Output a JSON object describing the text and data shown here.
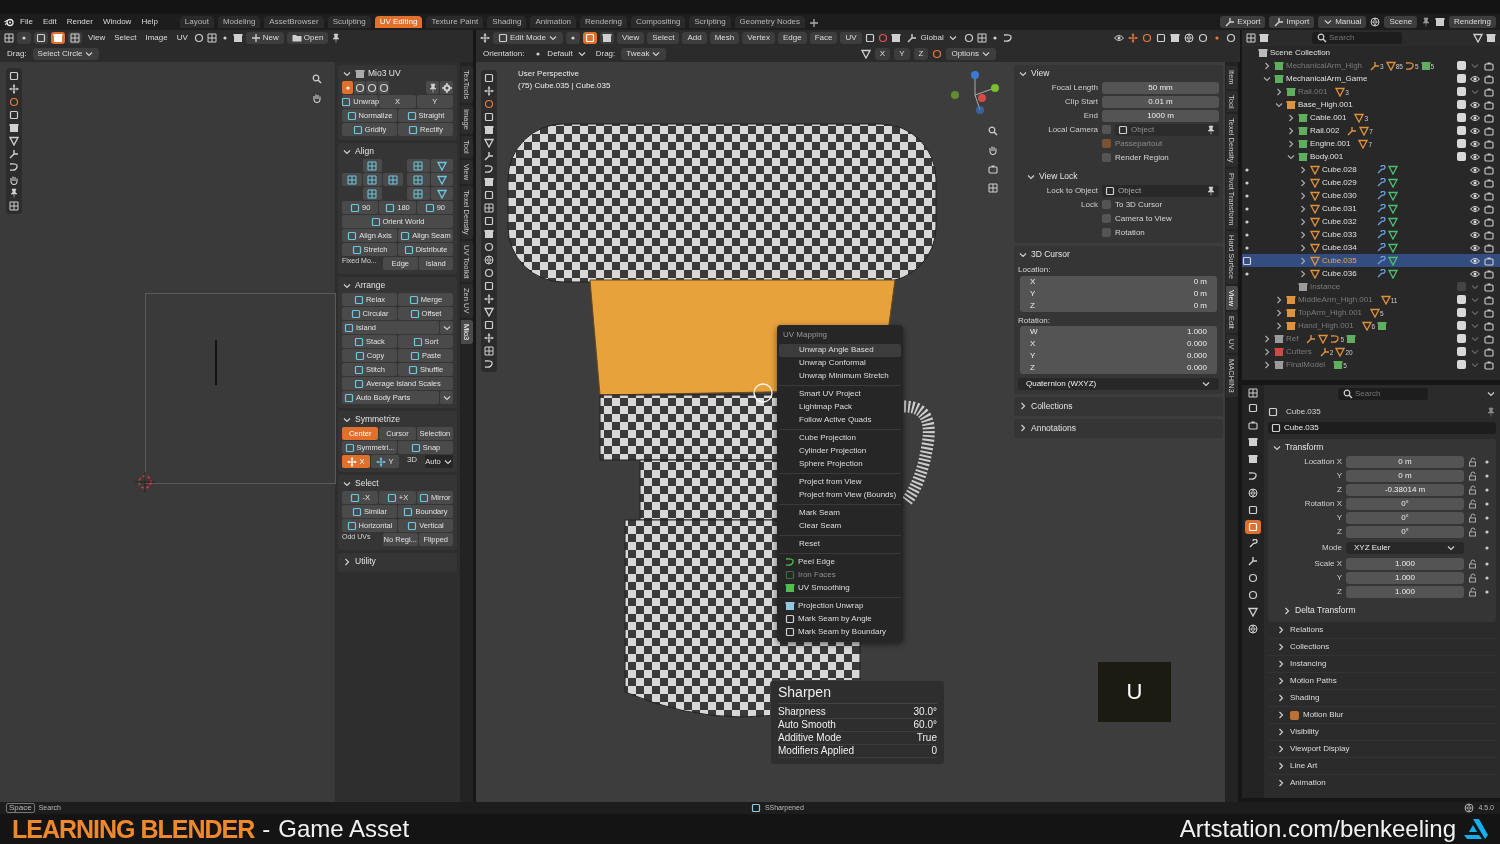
{
  "menubar": {
    "menus": [
      "File",
      "Edit",
      "Render",
      "Window",
      "Help"
    ]
  },
  "workspaces": [
    {
      "label": "Layout",
      "selected": false
    },
    {
      "label": "Modeling",
      "selected": false
    },
    {
      "label": "AssetBrowser",
      "selected": false
    },
    {
      "label": "Sculpting",
      "selected": false
    },
    {
      "label": "UV Editing",
      "selected": true
    },
    {
      "label": "Texture Paint",
      "selected": false
    },
    {
      "label": "Shading",
      "selected": false
    },
    {
      "label": "Animation",
      "selected": false
    },
    {
      "label": "Rendering",
      "selected": false
    },
    {
      "label": "Compositing",
      "selected": false
    },
    {
      "label": "Scripting",
      "selected": false
    },
    {
      "label": "Geometry Nodes",
      "selected": false
    }
  ],
  "topbar_right": {
    "buttons": [
      "Export",
      "Import",
      "Manual"
    ],
    "scene": "Scene",
    "view_layer": "Rendering"
  },
  "uv_editor": {
    "menus": [
      "View",
      "Select",
      "Image",
      "UV"
    ],
    "select_modes": [
      {
        "selected": false
      },
      {
        "selected": false
      },
      {
        "selected": true
      },
      {
        "selected": false
      }
    ],
    "new_label": "New",
    "open_label": "Open",
    "drag_label": "Drag:",
    "drag_value": "Select Circle"
  },
  "uv_sidebar": {
    "tabs": [
      {
        "label": "TexTools",
        "selected": false
      },
      {
        "label": "Image",
        "selected": false
      },
      {
        "label": "Tool",
        "selected": false
      },
      {
        "label": "View",
        "selected": false
      },
      {
        "label": "Texel Density",
        "selected": false
      },
      {
        "label": "UV Toolkit",
        "selected": false
      },
      {
        "label": "Zen UV",
        "selected": false
      },
      {
        "label": "Mio3",
        "selected": true
      }
    ],
    "sections": [
      {
        "title": "Mio3 UV",
        "expanded": true,
        "rows": [
          {
            "kind": "icons",
            "items": [
              {
                "selected": true
              },
              {
                "selected": false
              },
              {
                "selected": false
              },
              {
                "selected": false
              }
            ]
          },
          {
            "kind": "tools",
            "items": [
              {
                "label": "Unwrap",
                "kind": "tool"
              },
              {
                "label": "X",
                "kind": "plain"
              },
              {
                "label": "Y",
                "kind": "plain"
              }
            ]
          },
          {
            "kind": "tools",
            "items": [
              {
                "label": "Normalize",
                "kind": "tool"
              },
              {
                "label": "Straight",
                "kind": "tool"
              }
            ]
          },
          {
            "kind": "tools",
            "items": [
              {
                "label": "Gridify",
                "kind": "tool"
              },
              {
                "label": "Rectify",
                "kind": "tool"
              }
            ]
          }
        ]
      },
      {
        "title": "Align",
        "expanded": true,
        "rows": [
          {
            "kind": "align_grid"
          },
          {
            "kind": "tools",
            "items": [
              {
                "label": "90",
                "kind": "tool"
              },
              {
                "label": "180",
                "kind": "tool"
              },
              {
                "label": "90",
                "kind": "tool"
              }
            ]
          },
          {
            "kind": "tools",
            "items": [
              {
                "label": "Orient World",
                "kind": "tool"
              }
            ]
          },
          {
            "kind": "tools",
            "items": [
              {
                "label": "Align Axis",
                "kind": "tool"
              },
              {
                "label": "Align Seam",
                "kind": "tool"
              }
            ]
          },
          {
            "kind": "tools",
            "items": [
              {
                "label": "Stretch",
                "kind": "tool"
              },
              {
                "label": "Distribute",
                "kind": "tool"
              }
            ]
          },
          {
            "kind": "labeled",
            "label": "Fixed Mo...",
            "items": [
              {
                "label": "Edge",
                "selected": false
              },
              {
                "label": "Island",
                "selected": false
              }
            ]
          }
        ]
      },
      {
        "title": "Arrange",
        "expanded": true,
        "rows": [
          {
            "kind": "tools",
            "items": [
              {
                "label": "Relax",
                "kind": "tool"
              },
              {
                "label": "Merge",
                "kind": "tool"
              }
            ]
          },
          {
            "kind": "tools",
            "items": [
              {
                "label": "Circular",
                "kind": "tool"
              },
              {
                "label": "Offset",
                "kind": "tool"
              }
            ]
          },
          {
            "kind": "dropdown",
            "label": "Island"
          },
          {
            "kind": "tools",
            "items": [
              {
                "label": "Stack",
                "kind": "tool"
              },
              {
                "label": "Sort",
                "kind": "tool"
              }
            ]
          },
          {
            "kind": "tools",
            "items": [
              {
                "label": "Copy",
                "kind": "tool"
              },
              {
                "label": "Paste",
                "kind": "tool"
              }
            ]
          },
          {
            "kind": "tools",
            "items": [
              {
                "label": "Stitch",
                "kind": "tool"
              },
              {
                "label": "Shuffle",
                "kind": "tool"
              }
            ]
          },
          {
            "kind": "tools",
            "items": [
              {
                "label": "Average Island Scales",
                "kind": "tool"
              }
            ]
          },
          {
            "kind": "dropdown",
            "label": "Auto Body Parts"
          }
        ]
      },
      {
        "title": "Symmetrize",
        "expanded": true,
        "rows": [
          {
            "kind": "toggles",
            "items": [
              {
                "label": "Center",
                "selected": true
              },
              {
                "label": "Cursor",
                "selected": false
              },
              {
                "label": "Selection",
                "selected": false
              }
            ]
          },
          {
            "kind": "tools",
            "items": [
              {
                "label": "Symmetri...",
                "kind": "tool"
              },
              {
                "label": "Snap",
                "kind": "tool"
              }
            ]
          },
          {
            "kind": "axes",
            "items": [
              {
                "label": "X",
                "selected": true
              },
              {
                "label": "Y",
                "selected": false
              }
            ],
            "text": "3D",
            "value": "Auto"
          }
        ]
      },
      {
        "title": "Select",
        "expanded": true,
        "rows": [
          {
            "kind": "tools",
            "items": [
              {
                "label": "-X",
                "kind": "tool"
              },
              {
                "label": "+X",
                "kind": "tool"
              },
              {
                "label": "Mirror",
                "kind": "tool"
              }
            ]
          },
          {
            "kind": "tools",
            "items": [
              {
                "label": "Similar",
                "kind": "tool"
              },
              {
                "label": "Boundary",
                "kind": "tool"
              }
            ]
          },
          {
            "kind": "tools",
            "items": [
              {
                "label": "Horizontal",
                "kind": "tool"
              },
              {
                "label": "Vertical",
                "kind": "tool"
              }
            ]
          },
          {
            "kind": "labeled",
            "label": "Odd UVs",
            "items": [
              {
                "label": "No Regi...",
                "selected": false
              },
              {
                "label": "Flipped",
                "selected": false
              }
            ]
          }
        ]
      },
      {
        "title": "Utility",
        "expanded": false
      }
    ]
  },
  "viewport": {
    "mode": "Edit Mode",
    "select_modes": [
      {
        "selected": false
      },
      {
        "selected": true
      },
      {
        "selected": false
      }
    ],
    "menus": [
      "View",
      "Select",
      "Add",
      "Mesh",
      "Vertex",
      "Edge",
      "Face",
      "UV"
    ],
    "transform_orientation": "Global",
    "orientation_label": "Orientation:",
    "orientation": "Default",
    "drag_label": "Drag:",
    "drag": "Tweak",
    "mirror_axes": [
      "X",
      "Y",
      "Z"
    ],
    "options": "Options",
    "view_name": "User Perspective",
    "object_info": "(75) Cube.035 | Cube.035",
    "context_menu": {
      "title": "UV Mapping",
      "groups": [
        [
          {
            "label": "Unwrap Angle Based",
            "kind": "plain",
            "disabled": false,
            "highlighted": true
          },
          {
            "label": "Unwrap Conformal",
            "kind": "plain",
            "disabled": false,
            "highlighted": false
          },
          {
            "label": "Unwrap Minimum Stretch",
            "kind": "plain",
            "disabled": false,
            "highlighted": false
          }
        ],
        [
          {
            "label": "Smart UV Project",
            "kind": "plain",
            "disabled": false,
            "highlighted": false
          },
          {
            "label": "Lightmap Pack",
            "kind": "plain",
            "disabled": false,
            "highlighted": false
          },
          {
            "label": "Follow Active Quads",
            "kind": "plain",
            "disabled": false,
            "highlighted": false
          }
        ],
        [
          {
            "label": "Cube Projection",
            "kind": "plain",
            "disabled": false,
            "highlighted": false
          },
          {
            "label": "Cylinder Projection",
            "kind": "plain",
            "disabled": false,
            "highlighted": false
          },
          {
            "label": "Sphere Projection",
            "kind": "plain",
            "disabled": false,
            "highlighted": false
          }
        ],
        [
          {
            "label": "Project from View",
            "kind": "plain",
            "disabled": false,
            "highlighted": false
          },
          {
            "label": "Project from View (Bounds)",
            "kind": "plain",
            "disabled": false,
            "highlighted": false
          }
        ],
        [
          {
            "label": "Mark Seam",
            "kind": "plain",
            "disabled": false,
            "highlighted": false
          },
          {
            "label": "Clear Seam",
            "kind": "plain",
            "disabled": false,
            "highlighted": false
          }
        ],
        [
          {
            "label": "Reset",
            "kind": "plain",
            "disabled": false,
            "highlighted": false
          }
        ],
        [
          {
            "label": "Peel Edge",
            "kind": "peel",
            "disabled": false,
            "highlighted": false
          },
          {
            "label": "Iron Faces",
            "kind": "iron",
            "disabled": true,
            "highlighted": false
          },
          {
            "label": "UV Smoothing",
            "kind": "smooth",
            "disabled": false,
            "highlighted": false
          }
        ],
        [
          {
            "label": "Projection Unwrap",
            "kind": "unwrap",
            "disabled": false,
            "highlighted": false
          },
          {
            "label": "Mark Seam by Angle",
            "kind": "cube",
            "disabled": false,
            "highlighted": false
          },
          {
            "label": "Mark Seam by Boundary",
            "kind": "cube",
            "disabled": false,
            "highlighted": false
          }
        ]
      ]
    },
    "last_operator": {
      "title": "Sharpen",
      "rows": [
        {
          "label": "Sharpness",
          "value": "30.0°"
        },
        {
          "label": "Auto Smooth",
          "value": "60.0°"
        },
        {
          "label": "Additive Mode",
          "value": "True"
        },
        {
          "label": "Modifiers Applied",
          "value": "0"
        }
      ]
    },
    "key_overlay": "U"
  },
  "view_sidebar": {
    "tabs": [
      {
        "label": "Item",
        "selected": false
      },
      {
        "label": "Tool",
        "selected": false
      },
      {
        "label": "Texel Density",
        "selected": false
      },
      {
        "label": "Pivot Transform",
        "selected": false
      },
      {
        "label": "Hard Surface",
        "selected": false
      },
      {
        "label": "View",
        "selected": true
      },
      {
        "label": "Edit",
        "selected": false
      },
      {
        "label": "UV",
        "selected": false
      },
      {
        "label": "MACHIN3",
        "selected": false
      }
    ],
    "sections": [
      {
        "title": "View",
        "expanded": true,
        "rows": [
          {
            "kind": "number",
            "label": "Focal Length",
            "value": "50 mm"
          },
          {
            "kind": "number",
            "label": "Clip Start",
            "value": "0.01 m"
          },
          {
            "kind": "number",
            "label": "End",
            "value": "1000 m"
          },
          {
            "kind": "object",
            "label": "Local Camera",
            "checked": false,
            "placeholder": "Object",
            "disabled": true
          },
          {
            "kind": "check",
            "text": "Passepartout",
            "checked": true,
            "disabled": true
          },
          {
            "kind": "check",
            "text": "Render Region",
            "checked": false,
            "disabled": false
          },
          {
            "kind": "subsection",
            "title": "View Lock",
            "expanded": true
          },
          {
            "kind": "object",
            "label": "Lock to Object",
            "placeholder": "Object",
            "disabled": false
          },
          {
            "kind": "check",
            "label": "Lock",
            "text": "To 3D Cursor",
            "checked": false,
            "disabled": false
          },
          {
            "kind": "check",
            "text": "Camera to View",
            "checked": false,
            "disabled": false
          },
          {
            "kind": "check",
            "text": "Rotation",
            "checked": false,
            "disabled": false
          }
        ]
      },
      {
        "title": "3D Cursor",
        "expanded": true,
        "rows": [
          {
            "kind": "heading",
            "text": "Location:"
          },
          {
            "kind": "vector",
            "items": [
              {
                "axis": "X",
                "value": "0 m"
              },
              {
                "axis": "Y",
                "value": "0 m"
              },
              {
                "axis": "Z",
                "value": "0 m"
              }
            ]
          },
          {
            "kind": "heading",
            "text": "Rotation:"
          },
          {
            "kind": "vector",
            "items": [
              {
                "axis": "W",
                "value": "1.000"
              },
              {
                "axis": "X",
                "value": "0.000"
              },
              {
                "axis": "Y",
                "value": "0.000"
              },
              {
                "axis": "Z",
                "value": "0.000"
              }
            ]
          },
          {
            "kind": "dropdown",
            "value": "Quaternion (WXYZ)"
          }
        ]
      },
      {
        "title": "Collections",
        "expanded": false
      },
      {
        "title": "Annotations",
        "expanded": false
      }
    ]
  },
  "outliner": {
    "search_placeholder": "Search",
    "root": "Scene Collection",
    "items": [
      {
        "name": "MechanicalArm_High",
        "kind": "collection",
        "color": "#5fae5f",
        "expanded": false,
        "selected": false,
        "checked": true,
        "visible": false,
        "badges": [
          {
            "kind": "armature",
            "count": "3"
          },
          {
            "kind": "mesh",
            "count": "85"
          },
          {
            "kind": "curve",
            "count": "5"
          },
          {
            "kind": "collection",
            "count": "5"
          }
        ]
      },
      {
        "name": "MechanicalArm_Game",
        "kind": "collection",
        "color": "#5fae5f",
        "expanded": true,
        "selected": false,
        "checked": true,
        "visible": true,
        "children": [
          {
            "name": "Rail.001",
            "kind": "collection",
            "color": "#5fae5f",
            "expanded": false,
            "selected": false,
            "checked": true,
            "visible": false,
            "badges": [
              {
                "kind": "mesh",
                "count": "3"
              }
            ]
          },
          {
            "name": "Base_High.001",
            "kind": "collection",
            "color": "#e0913c",
            "expanded": true,
            "selected": false,
            "checked": true,
            "visible": true,
            "children": [
              {
                "name": "Cable.001",
                "kind": "collection",
                "color": "#5fae5f",
                "expanded": false,
                "selected": false,
                "checked": true,
                "visible": true,
                "badges": [
                  {
                    "kind": "mesh",
                    "count": "3"
                  }
                ]
              },
              {
                "name": "Rail.002",
                "kind": "collection",
                "color": "#5fae5f",
                "expanded": false,
                "selected": false,
                "checked": true,
                "visible": true,
                "badges": [
                  {
                    "kind": "armature"
                  },
                  {
                    "kind": "mesh",
                    "count": "7"
                  }
                ]
              },
              {
                "name": "Engine.001",
                "kind": "collection",
                "color": "#5fae5f",
                "expanded": false,
                "selected": false,
                "checked": true,
                "visible": true,
                "badges": [
                  {
                    "kind": "mesh",
                    "count": "7"
                  }
                ]
              },
              {
                "name": "Body.001",
                "kind": "collection",
                "color": "#5fae5f",
                "expanded": true,
                "selected": false,
                "checked": true,
                "visible": true,
                "children": [
                  {
                    "name": "Cube.028",
                    "kind": "object",
                    "in_edit_mode": true,
                    "expanded": false,
                    "selected": false,
                    "visible": true,
                    "badges": [
                      {
                        "kind": "modifier"
                      },
                      {
                        "kind": "meshdata"
                      }
                    ]
                  },
                  {
                    "name": "Cube.029",
                    "kind": "object",
                    "in_edit_mode": true,
                    "expanded": false,
                    "selected": false,
                    "visible": true,
                    "badges": [
                      {
                        "kind": "modifier"
                      },
                      {
                        "kind": "meshdata"
                      }
                    ]
                  },
                  {
                    "name": "Cube.030",
                    "kind": "object",
                    "in_edit_mode": true,
                    "expanded": false,
                    "selected": false,
                    "visible": true,
                    "badges": [
                      {
                        "kind": "modifier"
                      },
                      {
                        "kind": "meshdata"
                      }
                    ]
                  },
                  {
                    "name": "Cube.031",
                    "kind": "object",
                    "in_edit_mode": true,
                    "expanded": false,
                    "selected": false,
                    "visible": true,
                    "badges": [
                      {
                        "kind": "modifier"
                      },
                      {
                        "kind": "meshdata"
                      }
                    ]
                  },
                  {
                    "name": "Cube.032",
                    "kind": "object",
                    "in_edit_mode": true,
                    "expanded": false,
                    "selected": false,
                    "visible": true,
                    "badges": [
                      {
                        "kind": "modifier"
                      },
                      {
                        "kind": "meshdata"
                      }
                    ]
                  },
                  {
                    "name": "Cube.033",
                    "kind": "object",
                    "in_edit_mode": true,
                    "expanded": false,
                    "selected": false,
                    "visible": true,
                    "badges": [
                      {
                        "kind": "modifier"
                      },
                      {
                        "kind": "meshdata"
                      }
                    ]
                  },
                  {
                    "name": "Cube.034",
                    "kind": "object",
                    "in_edit_mode": true,
                    "expanded": false,
                    "selected": false,
                    "visible": true,
                    "badges": [
                      {
                        "kind": "modifier"
                      },
                      {
                        "kind": "meshdata"
                      }
                    ]
                  },
                  {
                    "name": "Cube.035",
                    "kind": "object",
                    "in_edit_mode": true,
                    "expanded": false,
                    "selected": true,
                    "visible": true,
                    "badges": [
                      {
                        "kind": "modifier"
                      },
                      {
                        "kind": "meshdata"
                      }
                    ]
                  },
                  {
                    "name": "Cube.036",
                    "kind": "object",
                    "in_edit_mode": true,
                    "expanded": false,
                    "selected": false,
                    "visible": true,
                    "badges": [
                      {
                        "kind": "modifier"
                      },
                      {
                        "kind": "meshdata"
                      }
                    ]
                  }
                ]
              },
              {
                "name": "Instance",
                "kind": "collection",
                "color": "#9a9a9a",
                "selected": false,
                "checked": false,
                "visible": false
              }
            ]
          },
          {
            "name": "MiddleArm_High.001",
            "kind": "collection",
            "color": "#e0913c",
            "expanded": false,
            "selected": false,
            "checked": true,
            "visible": false,
            "badges": [
              {
                "kind": "mesh",
                "count": "11"
              }
            ]
          },
          {
            "name": "TopArm_High.001",
            "kind": "collection",
            "color": "#e0913c",
            "expanded": false,
            "selected": false,
            "checked": true,
            "visible": false,
            "badges": [
              {
                "kind": "mesh",
                "count": "5"
              }
            ]
          },
          {
            "name": "Hand_High.001",
            "kind": "collection",
            "color": "#e0913c",
            "expanded": false,
            "selected": false,
            "checked": true,
            "visible": false,
            "badges": [
              {
                "kind": "mesh",
                "count": "6"
              },
              {
                "kind": "collection"
              }
            ]
          }
        ]
      },
      {
        "name": "Ref",
        "kind": "collection",
        "color": "#9a9a9a",
        "expanded": false,
        "selected": false,
        "checked": true,
        "visible": false,
        "badges": [
          {
            "kind": "armature"
          },
          {
            "kind": "mesh"
          },
          {
            "kind": "curve",
            "count": "5"
          },
          {
            "kind": "collection"
          }
        ]
      },
      {
        "name": "Cutters",
        "kind": "collection",
        "color": "#d04848",
        "expanded": false,
        "selected": false,
        "checked": true,
        "visible": false,
        "badges": [
          {
            "kind": "armature",
            "count": "2"
          },
          {
            "kind": "mesh",
            "count": "20"
          }
        ]
      },
      {
        "name": "FinalModel",
        "kind": "collection",
        "color": "#9a9a9a",
        "expanded": false,
        "selected": false,
        "checked": true,
        "visible": false,
        "badges": [
          {
            "kind": "collection",
            "count": "5"
          }
        ]
      }
    ]
  },
  "properties": {
    "search_placeholder": "Search",
    "tabs": [
      {
        "selected": false
      },
      {
        "selected": false
      },
      {
        "selected": false
      },
      {
        "selected": false
      },
      {
        "selected": false
      },
      {
        "selected": false
      },
      {
        "selected": false
      },
      {
        "selected": true
      },
      {
        "selected": false
      },
      {
        "selected": false
      },
      {
        "selected": false
      },
      {
        "selected": false
      },
      {
        "selected": false
      },
      {
        "selected": false
      }
    ],
    "object_name": "Cube.035",
    "data_name": "Cube.035",
    "transform": {
      "title": "Transform",
      "expanded": true,
      "rows": [
        {
          "kind": "number",
          "label": "Location X",
          "value": "0 m"
        },
        {
          "kind": "number",
          "label": "Y",
          "value": "0 m"
        },
        {
          "kind": "number",
          "label": "Z",
          "value": "-0.38014 m"
        },
        {
          "kind": "number",
          "label": "Rotation X",
          "value": "0°"
        },
        {
          "kind": "number",
          "label": "Y",
          "value": "0°"
        },
        {
          "kind": "number",
          "label": "Z",
          "value": "0°"
        },
        {
          "kind": "dropdown",
          "label": "Mode",
          "value": "XYZ Euler"
        },
        {
          "kind": "number",
          "label": "Scale X",
          "value": "1.000"
        },
        {
          "kind": "number",
          "label": "Y",
          "value": "1.000"
        },
        {
          "kind": "number",
          "label": "Z",
          "value": "1.000"
        }
      ],
      "subsection": {
        "title": "Delta Transform",
        "expanded": false
      }
    },
    "sections": [
      {
        "title": "Relations",
        "expanded": false
      },
      {
        "title": "Collections",
        "expanded": false
      },
      {
        "title": "Instancing",
        "expanded": false
      },
      {
        "title": "Motion Paths",
        "expanded": false
      },
      {
        "title": "Shading",
        "expanded": false
      },
      {
        "title": "Motion Blur",
        "expanded": false,
        "checked": true
      },
      {
        "title": "Visibility",
        "expanded": false
      },
      {
        "title": "Viewport Display",
        "expanded": false
      },
      {
        "title": "Line Art",
        "expanded": false
      },
      {
        "title": "Animation",
        "expanded": false
      }
    ]
  },
  "status_bar": {
    "key": "Space",
    "action": "Search",
    "message": "SSharpened",
    "version": "4.5.0"
  },
  "banner": {
    "title": "LEARNING BLENDER",
    "separator": "-",
    "subtitle": "Game Asset",
    "credit": "Artstation.com/benkeeling"
  }
}
